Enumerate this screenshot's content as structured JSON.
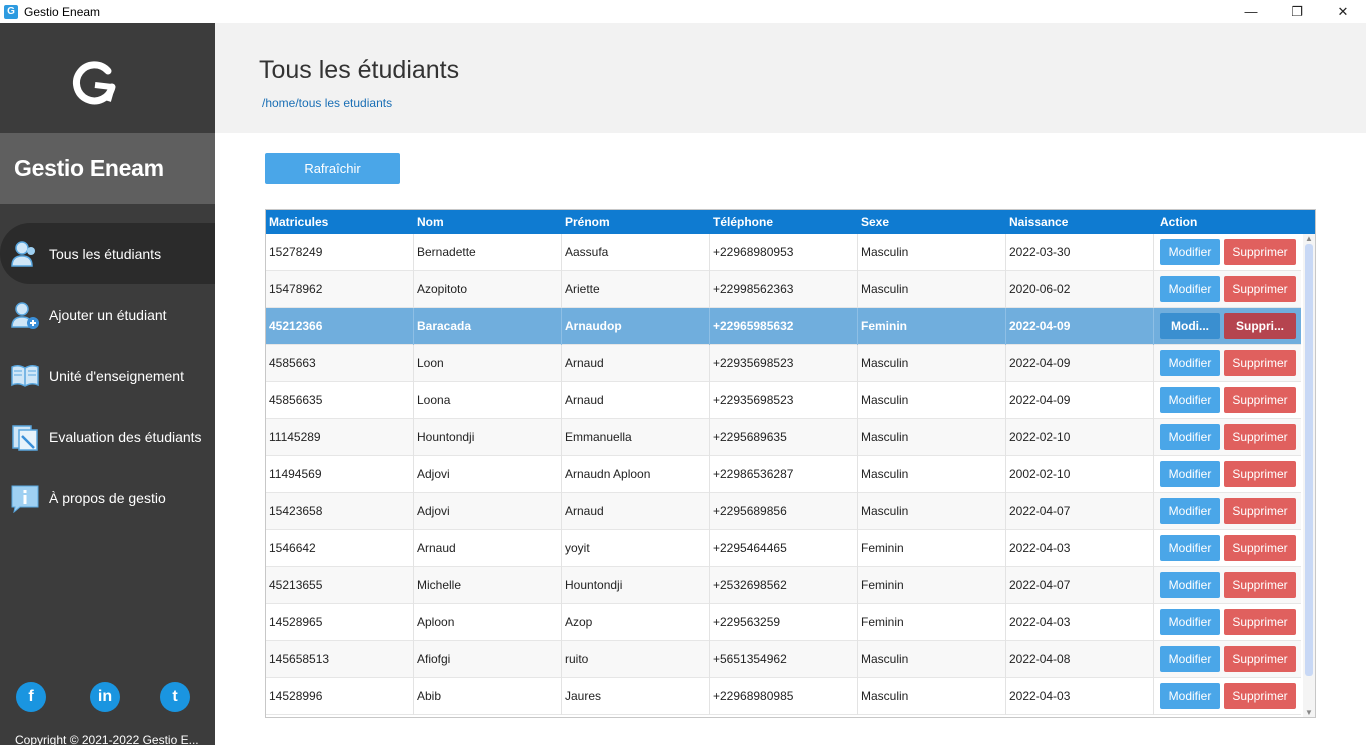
{
  "window": {
    "title": "Gestio Eneam",
    "icon_letter": "G",
    "minimize": "—",
    "restore": "❐",
    "close": "✕"
  },
  "sidebar": {
    "brand": "Gestio Eneam",
    "items": [
      {
        "label": "Tous les étudiants",
        "icon": "students-icon",
        "active": true
      },
      {
        "label": "Ajouter un étudiant",
        "icon": "add-student-icon",
        "active": false
      },
      {
        "label": "Unité d'enseignement",
        "icon": "book-icon",
        "active": false
      },
      {
        "label": "Evaluation des étudiants",
        "icon": "evaluation-icon",
        "active": false
      },
      {
        "label": "À propos de gestio",
        "icon": "info-icon",
        "active": false
      }
    ],
    "socials": [
      {
        "name": "facebook-icon",
        "glyph": "f"
      },
      {
        "name": "linkedin-icon",
        "glyph": "in"
      },
      {
        "name": "twitter-icon",
        "glyph": "t"
      }
    ],
    "copyright": "Copyright © 2021-2022 Gestio E..."
  },
  "header": {
    "title": "Tous les étudiants",
    "breadcrumb": "/home/tous les etudiants"
  },
  "toolbar": {
    "refresh_label": "Rafraîchir"
  },
  "table": {
    "columns": [
      "Matricules",
      "Nom",
      "Prénom",
      "Téléphone",
      "Sexe",
      "Naissance",
      "Action"
    ],
    "modify_label": "Modifier",
    "delete_label": "Supprimer",
    "modify_label_truncated": "Modi...",
    "delete_label_truncated": "Suppri...",
    "selected_index": 2,
    "rows": [
      [
        "15278249",
        "Bernadette",
        "Aassufa",
        "+22968980953",
        "Masculin",
        "2022-03-30"
      ],
      [
        "15478962",
        "Azopitoto",
        "Ariette",
        "+22998562363",
        "Masculin",
        "2020-06-02"
      ],
      [
        "45212366",
        "Baracada",
        "Arnaudop",
        "+22965985632",
        "Feminin",
        "2022-04-09"
      ],
      [
        "4585663",
        "Loon",
        "Arnaud",
        "+22935698523",
        "Masculin",
        "2022-04-09"
      ],
      [
        "45856635",
        "Loona",
        "Arnaud",
        "+22935698523",
        "Masculin",
        "2022-04-09"
      ],
      [
        "11145289",
        "Hountondji",
        "Emmanuella",
        "+2295689635",
        "Masculin",
        "2022-02-10"
      ],
      [
        "11494569",
        "Adjovi",
        "Arnaudn Aploon",
        "+22986536287",
        "Masculin",
        "2002-02-10"
      ],
      [
        "15423658",
        "Adjovi",
        "Arnaud",
        "+2295689856",
        "Masculin",
        "2022-04-07"
      ],
      [
        "1546642",
        "Arnaud",
        "yoyit",
        "+2295464465",
        "Feminin",
        "2022-04-03"
      ],
      [
        "45213655",
        "Michelle",
        "Hountondji",
        "+2532698562",
        "Feminin",
        "2022-04-07"
      ],
      [
        "14528965",
        "Aploon",
        "Azop",
        "+229563259",
        "Feminin",
        "2022-04-03"
      ],
      [
        "145658513",
        "Afiofgi",
        "ruito",
        "+5651354962",
        "Masculin",
        "2022-04-08"
      ],
      [
        "14528996",
        "Abib",
        "Jaures",
        "+22968980985",
        "Masculin",
        "2022-04-03"
      ]
    ]
  },
  "colors": {
    "sidebar_bg": "#3c3c3c",
    "accent": "#0f7bd1",
    "button_blue": "#4aa6e8",
    "button_red": "#e0605e",
    "selected_row": "#70aedd"
  }
}
